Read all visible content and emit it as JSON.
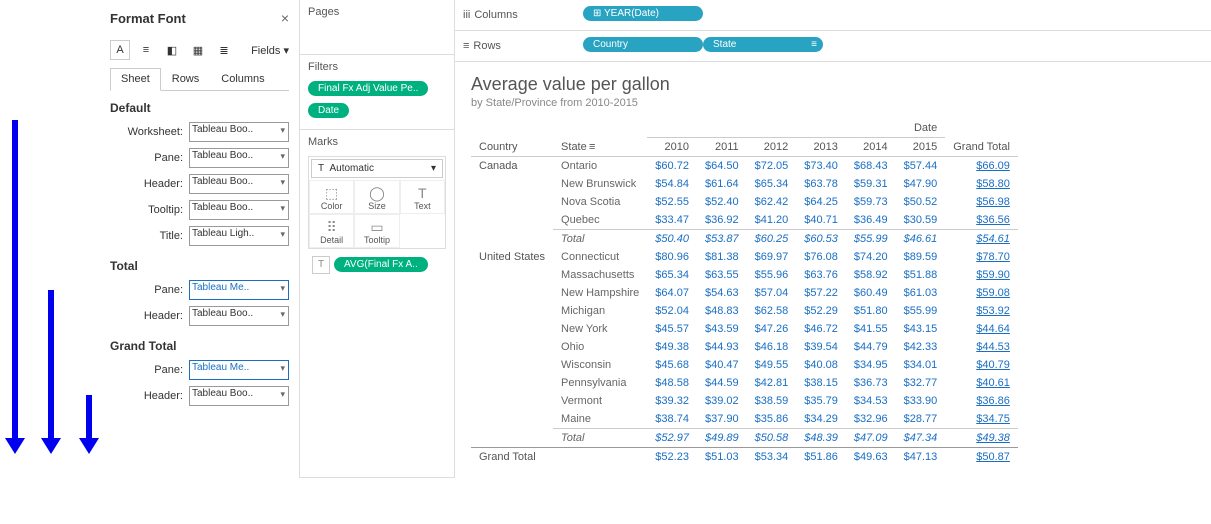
{
  "format_panel": {
    "title": "Format Font",
    "fields_label": "Fields ▾",
    "tabs": [
      "Sheet",
      "Rows",
      "Columns"
    ],
    "sections": {
      "default": {
        "title": "Default",
        "rows": [
          {
            "label": "Worksheet:",
            "value": "Tableau Boo.."
          },
          {
            "label": "Pane:",
            "value": "Tableau Boo.."
          },
          {
            "label": "Header:",
            "value": "Tableau Boo.."
          },
          {
            "label": "Tooltip:",
            "value": "Tableau Boo.."
          },
          {
            "label": "Title:",
            "value": "Tableau Ligh.."
          }
        ]
      },
      "total": {
        "title": "Total",
        "rows": [
          {
            "label": "Pane:",
            "value": "Tableau Me..",
            "hl": true
          },
          {
            "label": "Header:",
            "value": "Tableau Boo.."
          }
        ]
      },
      "grand": {
        "title": "Grand Total",
        "rows": [
          {
            "label": "Pane:",
            "value": "Tableau Me..",
            "hl": true
          },
          {
            "label": "Header:",
            "value": "Tableau Boo.."
          }
        ]
      }
    }
  },
  "shelves": {
    "pages": "Pages",
    "filters": {
      "title": "Filters",
      "pills": [
        "Final Fx Adj Value Pe..",
        "Date"
      ]
    },
    "marks": {
      "title": "Marks",
      "auto": "Automatic",
      "cells": [
        [
          "Color",
          "⬚"
        ],
        [
          "Size",
          "◯"
        ],
        [
          "Text",
          "T"
        ],
        [
          "Detail",
          "⠿"
        ],
        [
          "Tooltip",
          "▭"
        ]
      ],
      "measure": "AVG(Final Fx A.."
    }
  },
  "colrows": {
    "columns": {
      "label": "Columns",
      "pills": [
        {
          "text": "YEAR(Date)",
          "icon": "⊞"
        }
      ]
    },
    "rows": {
      "label": "Rows",
      "pills": [
        {
          "text": "Country"
        },
        {
          "text": "State",
          "sort": true
        }
      ]
    }
  },
  "viz": {
    "title": "Average value per gallon",
    "subtitle": "by State/Province from 2010-2015",
    "date_header": "Date",
    "headers": {
      "country": "Country",
      "state": "State",
      "years": [
        "2010",
        "2011",
        "2012",
        "2013",
        "2014",
        "2015"
      ],
      "gt": "Grand Total"
    },
    "groups": [
      {
        "country": "Canada",
        "rows": [
          {
            "state": "Ontario",
            "vals": [
              "$60.72",
              "$64.50",
              "$72.05",
              "$73.40",
              "$68.43",
              "$57.44"
            ],
            "gt": "$66.09"
          },
          {
            "state": "New Brunswick",
            "vals": [
              "$54.84",
              "$61.64",
              "$65.34",
              "$63.78",
              "$59.31",
              "$47.90"
            ],
            "gt": "$58.80"
          },
          {
            "state": "Nova Scotia",
            "vals": [
              "$52.55",
              "$52.40",
              "$62.42",
              "$64.25",
              "$59.73",
              "$50.52"
            ],
            "gt": "$56.98"
          },
          {
            "state": "Quebec",
            "vals": [
              "$33.47",
              "$36.92",
              "$41.20",
              "$40.71",
              "$36.49",
              "$30.59"
            ],
            "gt": "$36.56"
          }
        ],
        "total": {
          "label": "Total",
          "vals": [
            "$50.40",
            "$53.87",
            "$60.25",
            "$60.53",
            "$55.99",
            "$46.61"
          ],
          "gt": "$54.61"
        }
      },
      {
        "country": "United States",
        "rows": [
          {
            "state": "Connecticut",
            "vals": [
              "$80.96",
              "$81.38",
              "$69.97",
              "$76.08",
              "$74.20",
              "$89.59"
            ],
            "gt": "$78.70"
          },
          {
            "state": "Massachusetts",
            "vals": [
              "$65.34",
              "$63.55",
              "$55.96",
              "$63.76",
              "$58.92",
              "$51.88"
            ],
            "gt": "$59.90"
          },
          {
            "state": "New Hampshire",
            "vals": [
              "$64.07",
              "$54.63",
              "$57.04",
              "$57.22",
              "$60.49",
              "$61.03"
            ],
            "gt": "$59.08"
          },
          {
            "state": "Michigan",
            "vals": [
              "$52.04",
              "$48.83",
              "$62.58",
              "$52.29",
              "$51.80",
              "$55.99"
            ],
            "gt": "$53.92"
          },
          {
            "state": "New York",
            "vals": [
              "$45.57",
              "$43.59",
              "$47.26",
              "$46.72",
              "$41.55",
              "$43.15"
            ],
            "gt": "$44.64"
          },
          {
            "state": "Ohio",
            "vals": [
              "$49.38",
              "$44.93",
              "$46.18",
              "$39.54",
              "$44.79",
              "$42.33"
            ],
            "gt": "$44.53"
          },
          {
            "state": "Wisconsin",
            "vals": [
              "$45.68",
              "$40.47",
              "$49.55",
              "$40.08",
              "$34.95",
              "$34.01"
            ],
            "gt": "$40.79"
          },
          {
            "state": "Pennsylvania",
            "vals": [
              "$48.58",
              "$44.59",
              "$42.81",
              "$38.15",
              "$36.73",
              "$32.77"
            ],
            "gt": "$40.61"
          },
          {
            "state": "Vermont",
            "vals": [
              "$39.32",
              "$39.02",
              "$38.59",
              "$35.79",
              "$34.53",
              "$33.90"
            ],
            "gt": "$36.86"
          },
          {
            "state": "Maine",
            "vals": [
              "$38.74",
              "$37.90",
              "$35.86",
              "$34.29",
              "$32.96",
              "$28.77"
            ],
            "gt": "$34.75"
          }
        ],
        "total": {
          "label": "Total",
          "vals": [
            "$52.97",
            "$49.89",
            "$50.58",
            "$48.39",
            "$47.09",
            "$47.34"
          ],
          "gt": "$49.38"
        }
      }
    ],
    "grand": {
      "label": "Grand Total",
      "vals": [
        "$52.23",
        "$51.03",
        "$53.34",
        "$51.86",
        "$49.63",
        "$47.13"
      ],
      "gt": "$50.87"
    }
  }
}
